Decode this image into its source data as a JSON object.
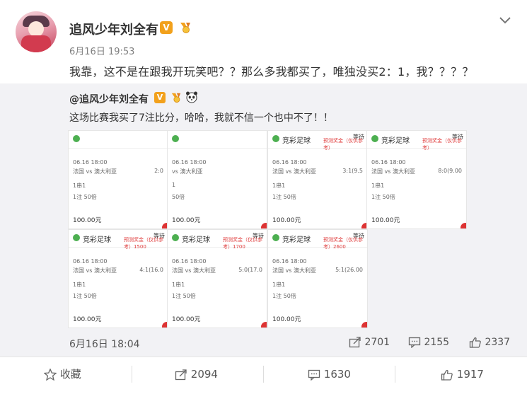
{
  "post": {
    "author": "追风少年刘全有",
    "vip_badge": "V",
    "time": "6月16日 19:53",
    "content": "我靠，这不是在跟我开玩笑吧？？那么多我都买了，唯独没买2：1，我？？？？"
  },
  "quoted": {
    "author": "@追风少年刘全有",
    "vip_badge": "V",
    "content": "这场比赛我买了7注比分，哈哈，我就不信一个也中不了！！",
    "date": "6月16日 18:04",
    "reposts": "2701",
    "comments": "2155",
    "likes": "2337",
    "tickets": [
      {
        "title": "",
        "wait": "",
        "prize": "",
        "date": "06.16 18:00",
        "teams": "法国 vs 澳大利亚",
        "score": "2:0",
        "bet": "1串1",
        "stake": "1注 50倍",
        "amount": "100.00元"
      },
      {
        "title": "",
        "wait": "",
        "prize": "",
        "date": "06.16 18:00",
        "teams": "vs 澳大利亚",
        "score": "",
        "bet": "1",
        "stake": "50倍",
        "amount": "100.00元"
      },
      {
        "title": "竞彩足球",
        "wait": "等待",
        "prize": "预测奖金（仅供参考）",
        "date": "06.16 18:00",
        "teams": "法国 vs 澳大利亚",
        "score": "3:1(9.5",
        "bet": "1串1",
        "stake": "1注 50倍",
        "amount": "100.00元"
      },
      {
        "title": "竞彩足球",
        "wait": "等待",
        "prize": "预测奖金（仅供参考）",
        "date": "06.16 18:00",
        "teams": "法国 vs 澳大利亚",
        "score": "8:0(9.00",
        "bet": "1串1",
        "stake": "1注 50倍",
        "amount": "100.00元"
      },
      {
        "title": "竞彩足球",
        "wait": "等待",
        "prize": "预测奖金（仅供参考）1500",
        "date": "06.16 18:00",
        "teams": "法国 vs 澳大利亚",
        "score": "4:1(16.0",
        "bet": "1串1",
        "stake": "1注 50倍",
        "amount": "100.00元"
      },
      {
        "title": "竞彩足球",
        "wait": "等待",
        "prize": "预测奖金（仅供参考）1700",
        "date": "06.16 18:00",
        "teams": "法国 vs 澳大利亚",
        "score": "5:0(17.0",
        "bet": "1串1",
        "stake": "1注 50倍",
        "amount": "100.00元"
      },
      {
        "title": "竞彩足球",
        "wait": "等待",
        "prize": "预测奖金（仅供参考）2600",
        "date": "06.16 18:00",
        "teams": "法国 vs 澳大利亚",
        "score": "5:1(26.00",
        "bet": "1串1",
        "stake": "1注 50倍",
        "amount": "100.00元"
      }
    ]
  },
  "actions": {
    "favorite": "收藏",
    "repost": "2094",
    "comment": "1630",
    "like": "1917"
  }
}
